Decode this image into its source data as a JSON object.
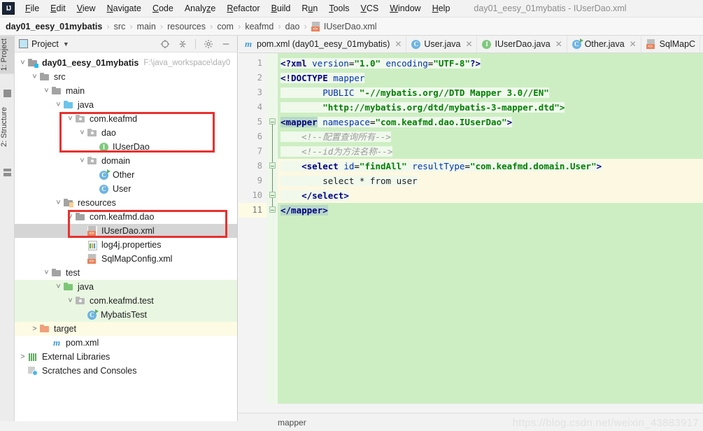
{
  "window": {
    "title": "day01_eesy_01mybatis - IUserDao.xml",
    "logo": "intellij-idea-logo"
  },
  "menubar": {
    "items": [
      {
        "label": "File",
        "mnemonic": "F"
      },
      {
        "label": "Edit",
        "mnemonic": "E"
      },
      {
        "label": "View",
        "mnemonic": "V"
      },
      {
        "label": "Navigate",
        "mnemonic": "N"
      },
      {
        "label": "Code",
        "mnemonic": "C"
      },
      {
        "label": "Analyze",
        "mnemonic": "z"
      },
      {
        "label": "Refactor",
        "mnemonic": "R"
      },
      {
        "label": "Build",
        "mnemonic": "B"
      },
      {
        "label": "Run",
        "mnemonic": "u"
      },
      {
        "label": "Tools",
        "mnemonic": "T"
      },
      {
        "label": "VCS",
        "mnemonic": "V"
      },
      {
        "label": "Window",
        "mnemonic": "W"
      },
      {
        "label": "Help",
        "mnemonic": "H"
      }
    ]
  },
  "breadcrumb": {
    "separator": "›",
    "items": [
      {
        "label": "day01_eesy_01mybatis",
        "icon": "",
        "bold": true
      },
      {
        "label": "src",
        "icon": "",
        "bold": false
      },
      {
        "label": "main",
        "icon": "",
        "bold": false
      },
      {
        "label": "resources",
        "icon": "",
        "bold": false
      },
      {
        "label": "com",
        "icon": "",
        "bold": false
      },
      {
        "label": "keafmd",
        "icon": "",
        "bold": false
      },
      {
        "label": "dao",
        "icon": "",
        "bold": false
      },
      {
        "label": "IUserDao.xml",
        "icon": "xml-file-icon",
        "bold": false
      }
    ]
  },
  "tool_strip": {
    "tabs": [
      {
        "label": "1: Project",
        "icon": "project-icon",
        "selected": true
      },
      {
        "label": "2: Structure",
        "icon": "structure-icon",
        "selected": false
      }
    ]
  },
  "project_panel": {
    "title": "Project",
    "title_icon": "project-view-icon",
    "dropdown_icon": "chevron-down-icon",
    "tools": [
      {
        "name": "locate-icon",
        "glyph": "⊕"
      },
      {
        "name": "collapse-all-icon",
        "glyph": "≡"
      },
      {
        "name": "settings-gear-icon",
        "glyph": "⚙"
      },
      {
        "name": "hide-panel-icon",
        "glyph": "─"
      }
    ],
    "tree": [
      {
        "label": "day01_eesy_01mybatis",
        "path": "F:\\java_workspace\\day0",
        "indent": 0,
        "arrow": "expanded",
        "icon": "module-folder-icon",
        "bold": true,
        "bg": "none",
        "selected": false
      },
      {
        "label": "src",
        "path": "",
        "indent": 1,
        "arrow": "expanded",
        "icon": "folder-icon",
        "bold": false,
        "bg": "none",
        "selected": false
      },
      {
        "label": "main",
        "path": "",
        "indent": 2,
        "arrow": "expanded",
        "icon": "folder-icon",
        "bold": false,
        "bg": "none",
        "selected": false
      },
      {
        "label": "java",
        "path": "",
        "indent": 3,
        "arrow": "expanded",
        "icon": "source-root-folder-icon",
        "bold": false,
        "bg": "none",
        "selected": false
      },
      {
        "label": "com.keafmd",
        "path": "",
        "indent": 4,
        "arrow": "expanded",
        "icon": "package-icon",
        "bold": false,
        "bg": "none",
        "selected": false
      },
      {
        "label": "dao",
        "path": "",
        "indent": 5,
        "arrow": "expanded",
        "icon": "package-icon",
        "bold": false,
        "bg": "none",
        "selected": false
      },
      {
        "label": "IUserDao",
        "path": "",
        "indent": 6,
        "arrow": "none",
        "icon": "interface-icon",
        "bold": false,
        "bg": "none",
        "selected": false
      },
      {
        "label": "domain",
        "path": "",
        "indent": 5,
        "arrow": "expanded",
        "icon": "package-icon",
        "bold": false,
        "bg": "none",
        "selected": false
      },
      {
        "label": "Other",
        "path": "",
        "indent": 6,
        "arrow": "none",
        "icon": "class-runnable-icon",
        "bold": false,
        "bg": "none",
        "selected": false
      },
      {
        "label": "User",
        "path": "",
        "indent": 6,
        "arrow": "none",
        "icon": "class-icon",
        "bold": false,
        "bg": "none",
        "selected": false
      },
      {
        "label": "resources",
        "path": "",
        "indent": 3,
        "arrow": "expanded",
        "icon": "resource-root-folder-icon",
        "bold": false,
        "bg": "none",
        "selected": false
      },
      {
        "label": "com.keafmd.dao",
        "path": "",
        "indent": 4,
        "arrow": "expanded",
        "icon": "folder-icon",
        "bold": false,
        "bg": "none",
        "selected": false
      },
      {
        "label": "IUserDao.xml",
        "path": "",
        "indent": 5,
        "arrow": "none",
        "icon": "xml-file-icon",
        "bold": false,
        "bg": "none",
        "selected": true
      },
      {
        "label": "log4j.properties",
        "path": "",
        "indent": 5,
        "arrow": "none",
        "icon": "properties-file-icon",
        "bold": false,
        "bg": "none",
        "selected": false
      },
      {
        "label": "SqlMapConfig.xml",
        "path": "",
        "indent": 5,
        "arrow": "none",
        "icon": "xml-file-icon",
        "bold": false,
        "bg": "none",
        "selected": false
      },
      {
        "label": "test",
        "path": "",
        "indent": 2,
        "arrow": "expanded",
        "icon": "folder-icon",
        "bold": false,
        "bg": "none",
        "selected": false
      },
      {
        "label": "java",
        "path": "",
        "indent": 3,
        "arrow": "expanded",
        "icon": "test-root-folder-icon",
        "bold": false,
        "bg": "green",
        "selected": false
      },
      {
        "label": "com.keafmd.test",
        "path": "",
        "indent": 4,
        "arrow": "expanded",
        "icon": "package-icon",
        "bold": false,
        "bg": "green",
        "selected": false
      },
      {
        "label": "MybatisTest",
        "path": "",
        "indent": 5,
        "arrow": "none",
        "icon": "class-runnable-icon",
        "bold": false,
        "bg": "green",
        "selected": false
      },
      {
        "label": "target",
        "path": "",
        "indent": 1,
        "arrow": "collapsed",
        "icon": "excluded-folder-icon",
        "bold": false,
        "bg": "yellow",
        "selected": false
      },
      {
        "label": "pom.xml",
        "path": "",
        "indent": 2,
        "arrow": "none",
        "icon": "maven-file-icon",
        "bold": false,
        "bg": "none",
        "selected": false
      },
      {
        "label": "External Libraries",
        "path": "",
        "indent": 0,
        "arrow": "collapsed",
        "icon": "libraries-icon",
        "bold": false,
        "bg": "none",
        "selected": false
      },
      {
        "label": "Scratches and Consoles",
        "path": "",
        "indent": 0,
        "arrow": "none",
        "icon": "scratches-icon",
        "bold": false,
        "bg": "none",
        "selected": false
      }
    ],
    "annotations": [
      {
        "name": "highlight-box-dao-package"
      },
      {
        "name": "highlight-box-resources-mapper"
      }
    ]
  },
  "editor": {
    "tabs": [
      {
        "label": "pom.xml (day01_eesy_01mybatis)",
        "icon": "maven-file-icon",
        "active": false,
        "closable": true
      },
      {
        "label": "User.java",
        "icon": "class-icon",
        "active": false,
        "closable": true
      },
      {
        "label": "IUserDao.java",
        "icon": "interface-icon",
        "active": false,
        "closable": true
      },
      {
        "label": "Other.java",
        "icon": "class-runnable-icon",
        "active": false,
        "closable": true
      },
      {
        "label": "SqlMapC",
        "icon": "xml-file-icon",
        "active": false,
        "closable": false
      }
    ],
    "line_numbers": [
      "1",
      "2",
      "3",
      "4",
      "5",
      "6",
      "7",
      "8",
      "9",
      "10",
      "11"
    ],
    "current_line": 11,
    "highlighted_lines": [
      8,
      9,
      10
    ],
    "code_lines": [
      {
        "n": 1,
        "tokens": [
          {
            "t": "<?xml ",
            "c": "tag"
          },
          {
            "t": "version",
            "c": "attr"
          },
          {
            "t": "=",
            "c": "plain"
          },
          {
            "t": "\"1.0\"",
            "c": "aval"
          },
          {
            "t": " ",
            "c": "plain"
          },
          {
            "t": "encoding",
            "c": "attr"
          },
          {
            "t": "=",
            "c": "plain"
          },
          {
            "t": "\"UTF-8\"",
            "c": "aval"
          },
          {
            "t": "?>",
            "c": "tag"
          }
        ]
      },
      {
        "n": 2,
        "tokens": [
          {
            "t": "<!DOCTYPE ",
            "c": "doctype"
          },
          {
            "t": "mapper",
            "c": "attr"
          }
        ]
      },
      {
        "n": 3,
        "tokens": [
          {
            "t": "        ",
            "c": "plain"
          },
          {
            "t": "PUBLIC ",
            "c": "attr"
          },
          {
            "t": "\"-//mybatis.org//DTD Mapper 3.0//EN\"",
            "c": "aval"
          }
        ]
      },
      {
        "n": 4,
        "tokens": [
          {
            "t": "        ",
            "c": "plain"
          },
          {
            "t": "\"http://mybatis.org/dtd/mybatis-3-mapper.dtd\">",
            "c": "aval"
          }
        ]
      },
      {
        "n": 5,
        "tokens": [
          {
            "t": "<mapper",
            "c": "tagsel"
          },
          {
            "t": " ",
            "c": "plain"
          },
          {
            "t": "namespace",
            "c": "attr"
          },
          {
            "t": "=",
            "c": "plain"
          },
          {
            "t": "\"com.keafmd.dao.IUserDao\"",
            "c": "aval"
          },
          {
            "t": ">",
            "c": "tag"
          }
        ]
      },
      {
        "n": 6,
        "tokens": [
          {
            "t": "    ",
            "c": "plain"
          },
          {
            "t": "<!--配置查询所有-->",
            "c": "comment"
          }
        ]
      },
      {
        "n": 7,
        "tokens": [
          {
            "t": "    ",
            "c": "plain"
          },
          {
            "t": "<!--id为方法名称-->",
            "c": "comment"
          }
        ]
      },
      {
        "n": 8,
        "tokens": [
          {
            "t": "    ",
            "c": "plain"
          },
          {
            "t": "<select ",
            "c": "tag"
          },
          {
            "t": "id",
            "c": "attr"
          },
          {
            "t": "=",
            "c": "plain"
          },
          {
            "t": "\"findAll\"",
            "c": "aval"
          },
          {
            "t": " ",
            "c": "plain"
          },
          {
            "t": "resultType",
            "c": "attr"
          },
          {
            "t": "=",
            "c": "plain"
          },
          {
            "t": "\"com.keafmd.domain.User\"",
            "c": "aval"
          },
          {
            "t": ">",
            "c": "tag"
          }
        ]
      },
      {
        "n": 9,
        "tokens": [
          {
            "t": "        select * from user",
            "c": "txt"
          }
        ]
      },
      {
        "n": 10,
        "tokens": [
          {
            "t": "    ",
            "c": "plain"
          },
          {
            "t": "</select>",
            "c": "tag"
          }
        ]
      },
      {
        "n": 11,
        "tokens": [
          {
            "t": "</mapper>",
            "c": "tagsel"
          }
        ]
      }
    ],
    "status": {
      "label": "mapper"
    }
  },
  "watermark": {
    "text": "https://blog.csdn.net/weixin_43883917"
  },
  "colors": {
    "editor_background": "#cdeec3",
    "highlight_yellow": "#fdf8e2",
    "accent_blue": "#4083c9",
    "annotation_red": "#e8312f",
    "source_root_blue": "#6cc4ea",
    "test_root_green": "#7cc576",
    "excluded_orange": "#f0a07a"
  }
}
